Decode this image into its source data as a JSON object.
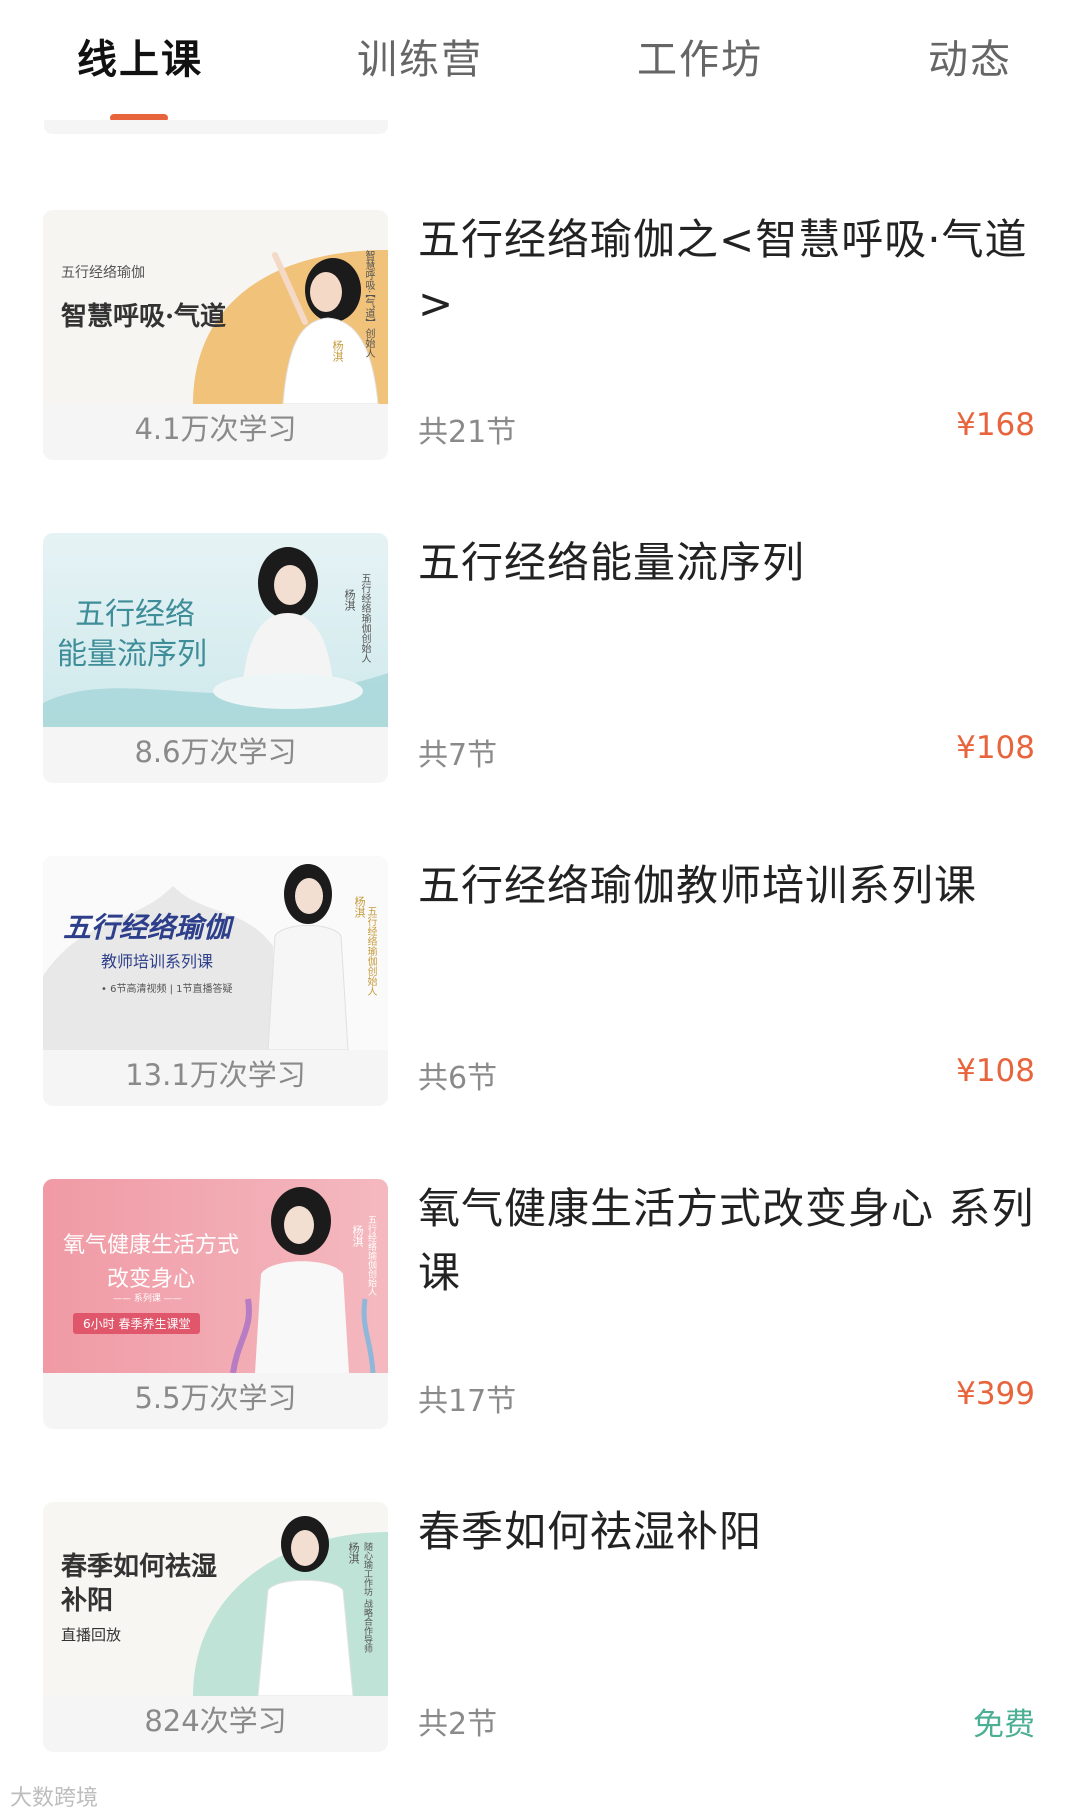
{
  "tabs": [
    {
      "label": "线上课",
      "active": true
    },
    {
      "label": "训练营",
      "active": false
    },
    {
      "label": "工作坊",
      "active": false
    },
    {
      "label": "动态",
      "active": false
    }
  ],
  "courses": [
    {
      "title": "五行经络瑜伽之<智慧呼吸·气道>",
      "learners": "4.1万次学习",
      "lessons": "共21节",
      "price": "¥168",
      "thumb": {
        "title": "智慧呼吸·气道",
        "subtitle": "五行经络瑜伽",
        "vertical": "智慧呼吸·【气道】创始人",
        "name": "杨淇"
      }
    },
    {
      "title": "五行经络能量流序列",
      "learners": "8.6万次学习",
      "lessons": "共7节",
      "price": "¥108",
      "thumb": {
        "title_line1": "五行经络",
        "title_line2": "能量流序列",
        "vertical": "五行经络瑜伽创始人",
        "name": "杨淇"
      }
    },
    {
      "title": "五行经络瑜伽教师培训系列课",
      "learners": "13.1万次学习",
      "lessons": "共6节",
      "price": "¥108",
      "thumb": {
        "title": "五行经络瑜伽",
        "subtitle": "教师培训系列课",
        "note": "• 6节高清视频 | 1节直播答疑",
        "vertical": "五行经络瑜伽创始人",
        "name": "杨淇"
      }
    },
    {
      "title": "氧气健康生活方式改变身心 系列课",
      "learners": "5.5万次学习",
      "lessons": "共17节",
      "price": "¥399",
      "thumb": {
        "title_line1": "氧气健康生活方式",
        "title_line2": "改变身心",
        "series": "—— 系列课 ——",
        "badge": "6小时 春季养生课堂",
        "vertical": "五行经络瑜伽创始人",
        "name": "杨淇"
      }
    },
    {
      "title": "春季如何祛湿补阳",
      "learners": "824次学习",
      "lessons": "共2节",
      "price": "免费",
      "thumb": {
        "title_line1": "春季如何祛湿",
        "title_line2": "补阳",
        "subtitle": "直播回放",
        "vertical": "随心瑜工作坊 战略合作导师",
        "name": "杨淇"
      }
    }
  ],
  "watermark": "大数跨境",
  "colors": {
    "accent": "#e8643c",
    "free": "#4caf93"
  }
}
